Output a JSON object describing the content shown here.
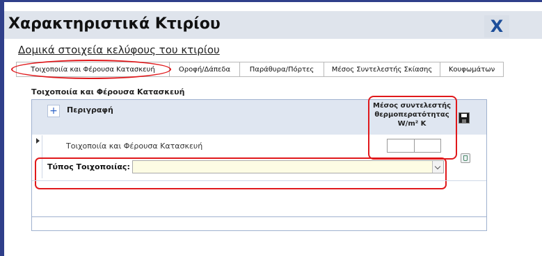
{
  "window": {
    "title": "Χαρακτηριστικά Κτιρίου",
    "close_label": "X"
  },
  "section": {
    "title": "Δομικά στοιχεία κελύφους του κτιρίου"
  },
  "tabs": [
    {
      "label": "Τοιχοποιία και Φέρουσα Κατασκευή",
      "active": true
    },
    {
      "label": "Οροφή/Δάπεδα",
      "active": false
    },
    {
      "label": "Παράθυρα/Πόρτες",
      "active": false
    },
    {
      "label": "Μέσος Συντελεστής Σκίασης",
      "active": false
    },
    {
      "label": "Κουφωμάτων",
      "active": false
    }
  ],
  "panel": {
    "title": "Τοιχοποιία και Φέρουσα Κατασκευή",
    "add_label": "+",
    "columns": {
      "description": "Περιγραφή",
      "coefficient_line1": "Μέσος συντελεστής",
      "coefficient_line2": "θερμοπερατότητας",
      "coefficient_unit": "W/m² K"
    },
    "rows": [
      {
        "description": "Τοιχοποιία και Φέρουσα Κατασκευή",
        "coefficient_value": "",
        "type_label": "Τύπος Τοιχοποιίας:",
        "type_value": ""
      }
    ]
  },
  "icons": {
    "close": "close-icon",
    "save": "save-icon",
    "delete": "delete-icon",
    "dropdown": "chevron-down-icon",
    "row_marker": "record-pointer-icon"
  },
  "colors": {
    "highlight": "#e0181b",
    "header_bg": "#dfe4ec",
    "accent": "#1d4e9a"
  }
}
